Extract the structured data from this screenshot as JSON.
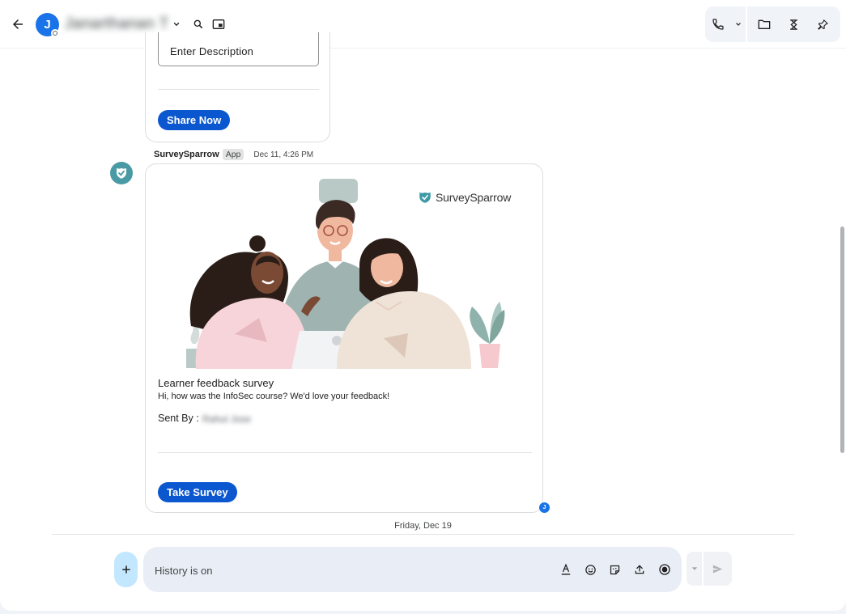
{
  "header": {
    "avatar_letter": "J",
    "contact_name": "Janarthanan T"
  },
  "card1": {
    "description_placeholder": "Enter Description",
    "share_label": "Share Now"
  },
  "message": {
    "sender": "SurveySparrow",
    "badge": "App",
    "time": "Dec 11, 4:26 PM",
    "brand": "SurveySparrow",
    "title": "Learner feedback survey",
    "description": "Hi, how was the InfoSec course? We'd love your feedback!",
    "sent_by_label": "Sent By :",
    "sent_by_name": "Rahul Jose",
    "button_label": "Take Survey",
    "read_receipt_letter": "J"
  },
  "date_separator": "Friday, Dec 19",
  "compose": {
    "placeholder": "History is on"
  },
  "colors": {
    "primary_button": "#0b57d0",
    "avatar": "#1a73e8",
    "bot_avatar": "#4a9aa5",
    "compose_bg": "#e9eef6"
  },
  "icons": [
    "arrow-back-icon",
    "chevron-down-icon",
    "search-icon",
    "picture-in-picture-icon",
    "phone-icon",
    "folder-icon",
    "tasks-icon",
    "pin-icon",
    "plus-icon",
    "format-text-icon",
    "emoji-icon",
    "sticker-icon",
    "upload-icon",
    "record-icon",
    "send-icon"
  ]
}
